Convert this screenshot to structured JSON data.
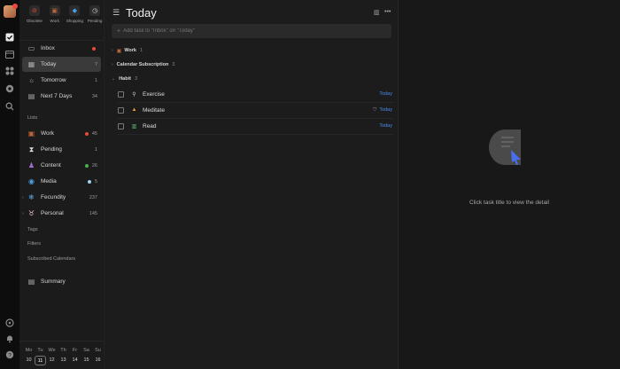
{
  "quick_filters": [
    {
      "label": "Obsolete",
      "icon": "no-icon"
    },
    {
      "label": "Work",
      "icon": "briefcase-icon"
    },
    {
      "label": "Shopping",
      "icon": "cart-icon"
    },
    {
      "label": "Pending",
      "icon": "clock-icon"
    }
  ],
  "nav": {
    "inbox": {
      "label": "Inbox"
    },
    "today": {
      "label": "Today",
      "count": "7"
    },
    "tomorrow": {
      "label": "Tomorrow",
      "count": "1"
    },
    "next7": {
      "label": "Next 7 Days",
      "count": "34"
    }
  },
  "lists_label": "Lists",
  "lists": [
    {
      "label": "Work",
      "count": "45",
      "icon": "briefcase-icon"
    },
    {
      "label": "Pending",
      "count": "1",
      "icon": "hourglass-icon"
    },
    {
      "label": "Content",
      "count": "26",
      "icon": "people-icon"
    },
    {
      "label": "Media",
      "count": "5",
      "icon": "media-icon"
    },
    {
      "label": "Fecundity",
      "count": "237",
      "icon": "snowflake-icon"
    },
    {
      "label": "Personal",
      "count": "145",
      "icon": "cow-icon"
    }
  ],
  "tags_label": "Tags",
  "filters_label": "Filters",
  "subscribed_label": "Subscribed Calendars",
  "summary_label": "Summary",
  "calendar": {
    "weekdays": [
      "Mo",
      "Tu",
      "We",
      "Th",
      "Fr",
      "Sa",
      "Su"
    ],
    "days": [
      "10",
      "11",
      "12",
      "13",
      "14",
      "15",
      "16"
    ],
    "today": "11"
  },
  "main": {
    "title": "Today",
    "add_placeholder": "Add task to \"Inbox\" on \"Today\"",
    "groups": {
      "work": {
        "label": "Work",
        "count": "1"
      },
      "calendar": {
        "label": "Calendar Subscription",
        "count": "3"
      },
      "habit": {
        "label": "Habit",
        "count": "3"
      }
    },
    "tasks": [
      {
        "name": "Exercise",
        "date": "Today"
      },
      {
        "name": "Meditate",
        "date": "Today"
      },
      {
        "name": "Read",
        "date": "Today"
      }
    ]
  },
  "detail": {
    "empty_text": "Click task title to view the detail"
  },
  "colors": {
    "accent": "#4a8cf0",
    "inbox_dot": "#e84a3a",
    "work_dot": "#e84a3a",
    "content_dot": "#4caf50",
    "media_dot": "#9fd3f0"
  }
}
